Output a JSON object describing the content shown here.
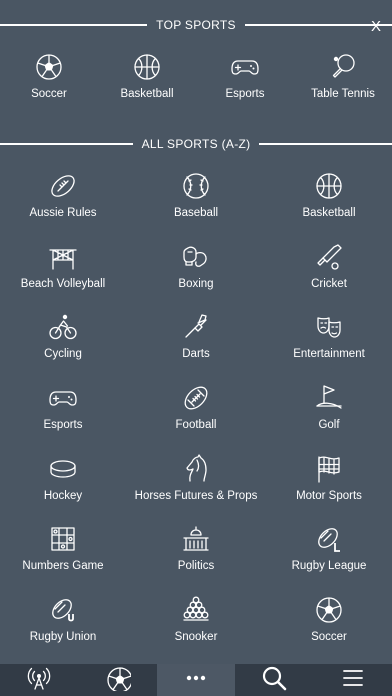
{
  "close": {
    "label": "X"
  },
  "top_sports": {
    "title": "TOP SPORTS",
    "items": [
      {
        "label": "Soccer",
        "icon": "soccer-ball-icon"
      },
      {
        "label": "Basketball",
        "icon": "basketball-icon"
      },
      {
        "label": "Esports",
        "icon": "gamepad-icon"
      },
      {
        "label": "Table Tennis",
        "icon": "table-tennis-icon"
      }
    ]
  },
  "all_sports": {
    "title": "ALL SPORTS (A-Z)",
    "items": [
      {
        "label": "Aussie Rules",
        "icon": "aussie-rules-ball-icon"
      },
      {
        "label": "Baseball",
        "icon": "baseball-icon"
      },
      {
        "label": "Basketball",
        "icon": "basketball-icon"
      },
      {
        "label": "Beach Volleyball",
        "icon": "volleyball-net-icon"
      },
      {
        "label": "Boxing",
        "icon": "boxing-gloves-icon"
      },
      {
        "label": "Cricket",
        "icon": "cricket-bat-icon"
      },
      {
        "label": "Cycling",
        "icon": "cyclist-icon"
      },
      {
        "label": "Darts",
        "icon": "dart-icon"
      },
      {
        "label": "Entertainment",
        "icon": "theater-masks-icon"
      },
      {
        "label": "Esports",
        "icon": "gamepad-icon"
      },
      {
        "label": "Football",
        "icon": "football-icon"
      },
      {
        "label": "Golf",
        "icon": "golf-flag-icon"
      },
      {
        "label": "Hockey",
        "icon": "hockey-puck-icon"
      },
      {
        "label": "Horses Futures & Props",
        "icon": "horse-head-icon"
      },
      {
        "label": "Motor Sports",
        "icon": "checkered-flag-icon"
      },
      {
        "label": "Numbers Game",
        "icon": "numbers-grid-icon"
      },
      {
        "label": "Politics",
        "icon": "capitol-building-icon"
      },
      {
        "label": "Rugby League",
        "icon": "rugby-league-ball-icon"
      },
      {
        "label": "Rugby Union",
        "icon": "rugby-union-ball-icon"
      },
      {
        "label": "Snooker",
        "icon": "snooker-balls-icon"
      },
      {
        "label": "Soccer",
        "icon": "soccer-ball-icon"
      }
    ]
  },
  "tabbar": {
    "tabs": [
      {
        "icon": "live-broadcast-icon"
      },
      {
        "icon": "soccer-ball-icon"
      },
      {
        "icon": "more-dots-icon",
        "active": true
      },
      {
        "icon": "search-icon"
      },
      {
        "icon": "menu-icon"
      }
    ]
  },
  "colors": {
    "background": "#4a5663",
    "tabbar": "#323b46",
    "active_tab": "#4d5865",
    "foreground": "#ffffff"
  }
}
